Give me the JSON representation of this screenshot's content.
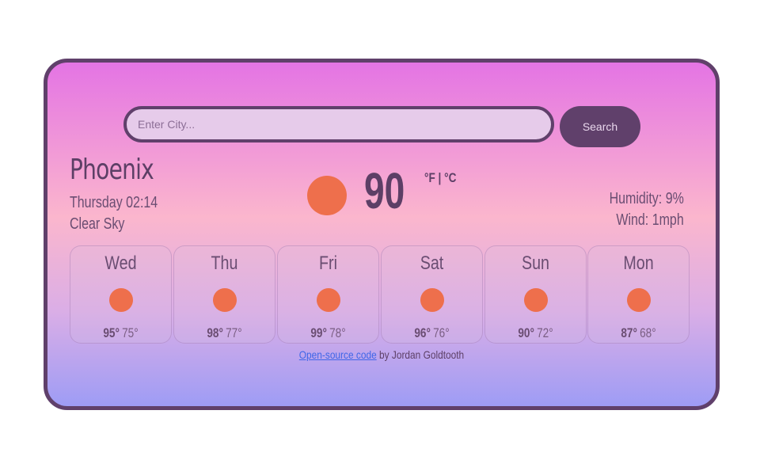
{
  "search": {
    "placeholder": "Enter City...",
    "value": "",
    "button_label": "Search"
  },
  "current": {
    "city": "Phoenix",
    "datetime": "Thursday 02:14",
    "condition": "Clear Sky",
    "icon": "sun-icon",
    "temperature": "90",
    "unit_f": "°F",
    "unit_separator": "|",
    "unit_c": "°C",
    "humidity": "Humidity: 9%",
    "wind": "Wind: 1mph"
  },
  "forecast": [
    {
      "day": "Wed",
      "icon": "sun-icon",
      "high": "95°",
      "low": "75°"
    },
    {
      "day": "Thu",
      "icon": "sun-icon",
      "high": "98°",
      "low": "77°"
    },
    {
      "day": "Fri",
      "icon": "sun-icon",
      "high": "99°",
      "low": "78°"
    },
    {
      "day": "Sat",
      "icon": "sun-icon",
      "high": "96°",
      "low": "76°"
    },
    {
      "day": "Sun",
      "icon": "sun-icon",
      "high": "90°",
      "low": "72°"
    },
    {
      "day": "Mon",
      "icon": "sun-icon",
      "high": "87°",
      "low": "68°"
    }
  ],
  "footer": {
    "link_text": "Open-source code",
    "suffix": " by Jordan Goldtooth"
  },
  "colors": {
    "frame": "#60406b",
    "sun": "#ee6f4c",
    "link": "#3f66e8",
    "gradient_top": "#e474e4",
    "gradient_bottom": "#9e9cf5"
  }
}
